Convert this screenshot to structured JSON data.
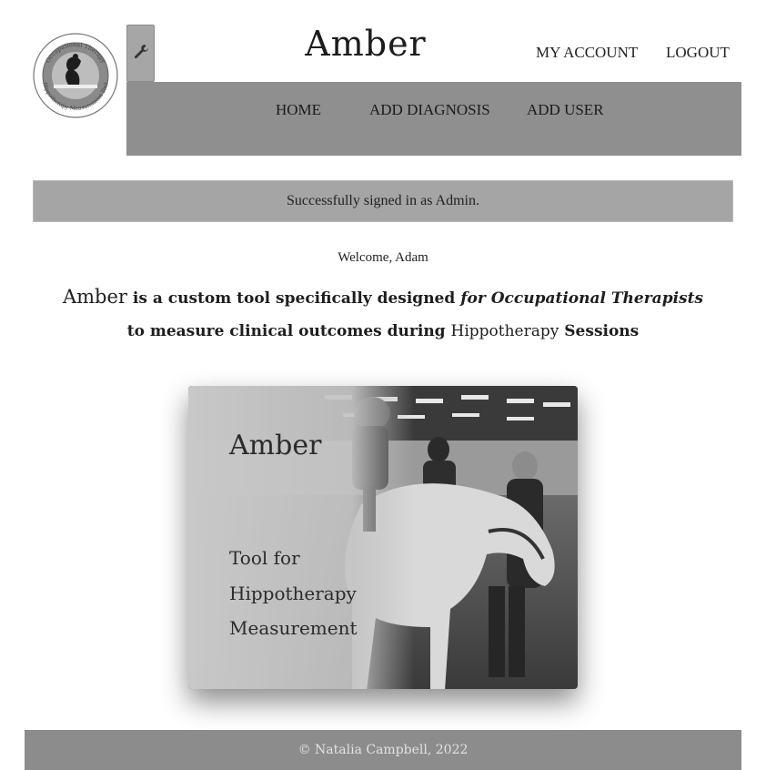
{
  "header": {
    "title": "Amber",
    "logo": {
      "alt": "Occupational Therapy Hippotherapy Measurement Tool logo",
      "ring_text_top": "Occupational Therapy",
      "ring_text_bottom": "Hippotherapy Measurement Tool"
    },
    "tools_icon": "wrench-icon",
    "account_links": [
      "MY ACCOUNT",
      "LOGOUT"
    ]
  },
  "nav": {
    "items": [
      "HOME",
      "ADD DIAGNOSIS",
      "ADD USER"
    ]
  },
  "alert": {
    "message": "Successfully signed in as Admin."
  },
  "main": {
    "welcome": "Welcome, Adam",
    "intro": {
      "brand": "Amber",
      "part1": " is a custom tool specifically designed ",
      "for": "for",
      "role": "Occupational Therapists",
      "part2": " to measure clinical outcomes during ",
      "therapy": "Hippotherapy",
      "part3": " Sessions"
    },
    "hero": {
      "title": "Amber",
      "subtitle_lines": [
        "Tool for",
        "Hippotherapy",
        "Measurement"
      ],
      "image_alt": "Child riding a white horse in an indoor arena, assisted by therapists"
    }
  },
  "footer": {
    "copyright": "© Natalia Campbell, 2022"
  },
  "colors": {
    "nav_bg": "#8f8f8f",
    "alert_bg": "#a5a5a5",
    "footer_bg": "#8c8c8c",
    "tools_btn_bg": "#a6a6a6"
  }
}
